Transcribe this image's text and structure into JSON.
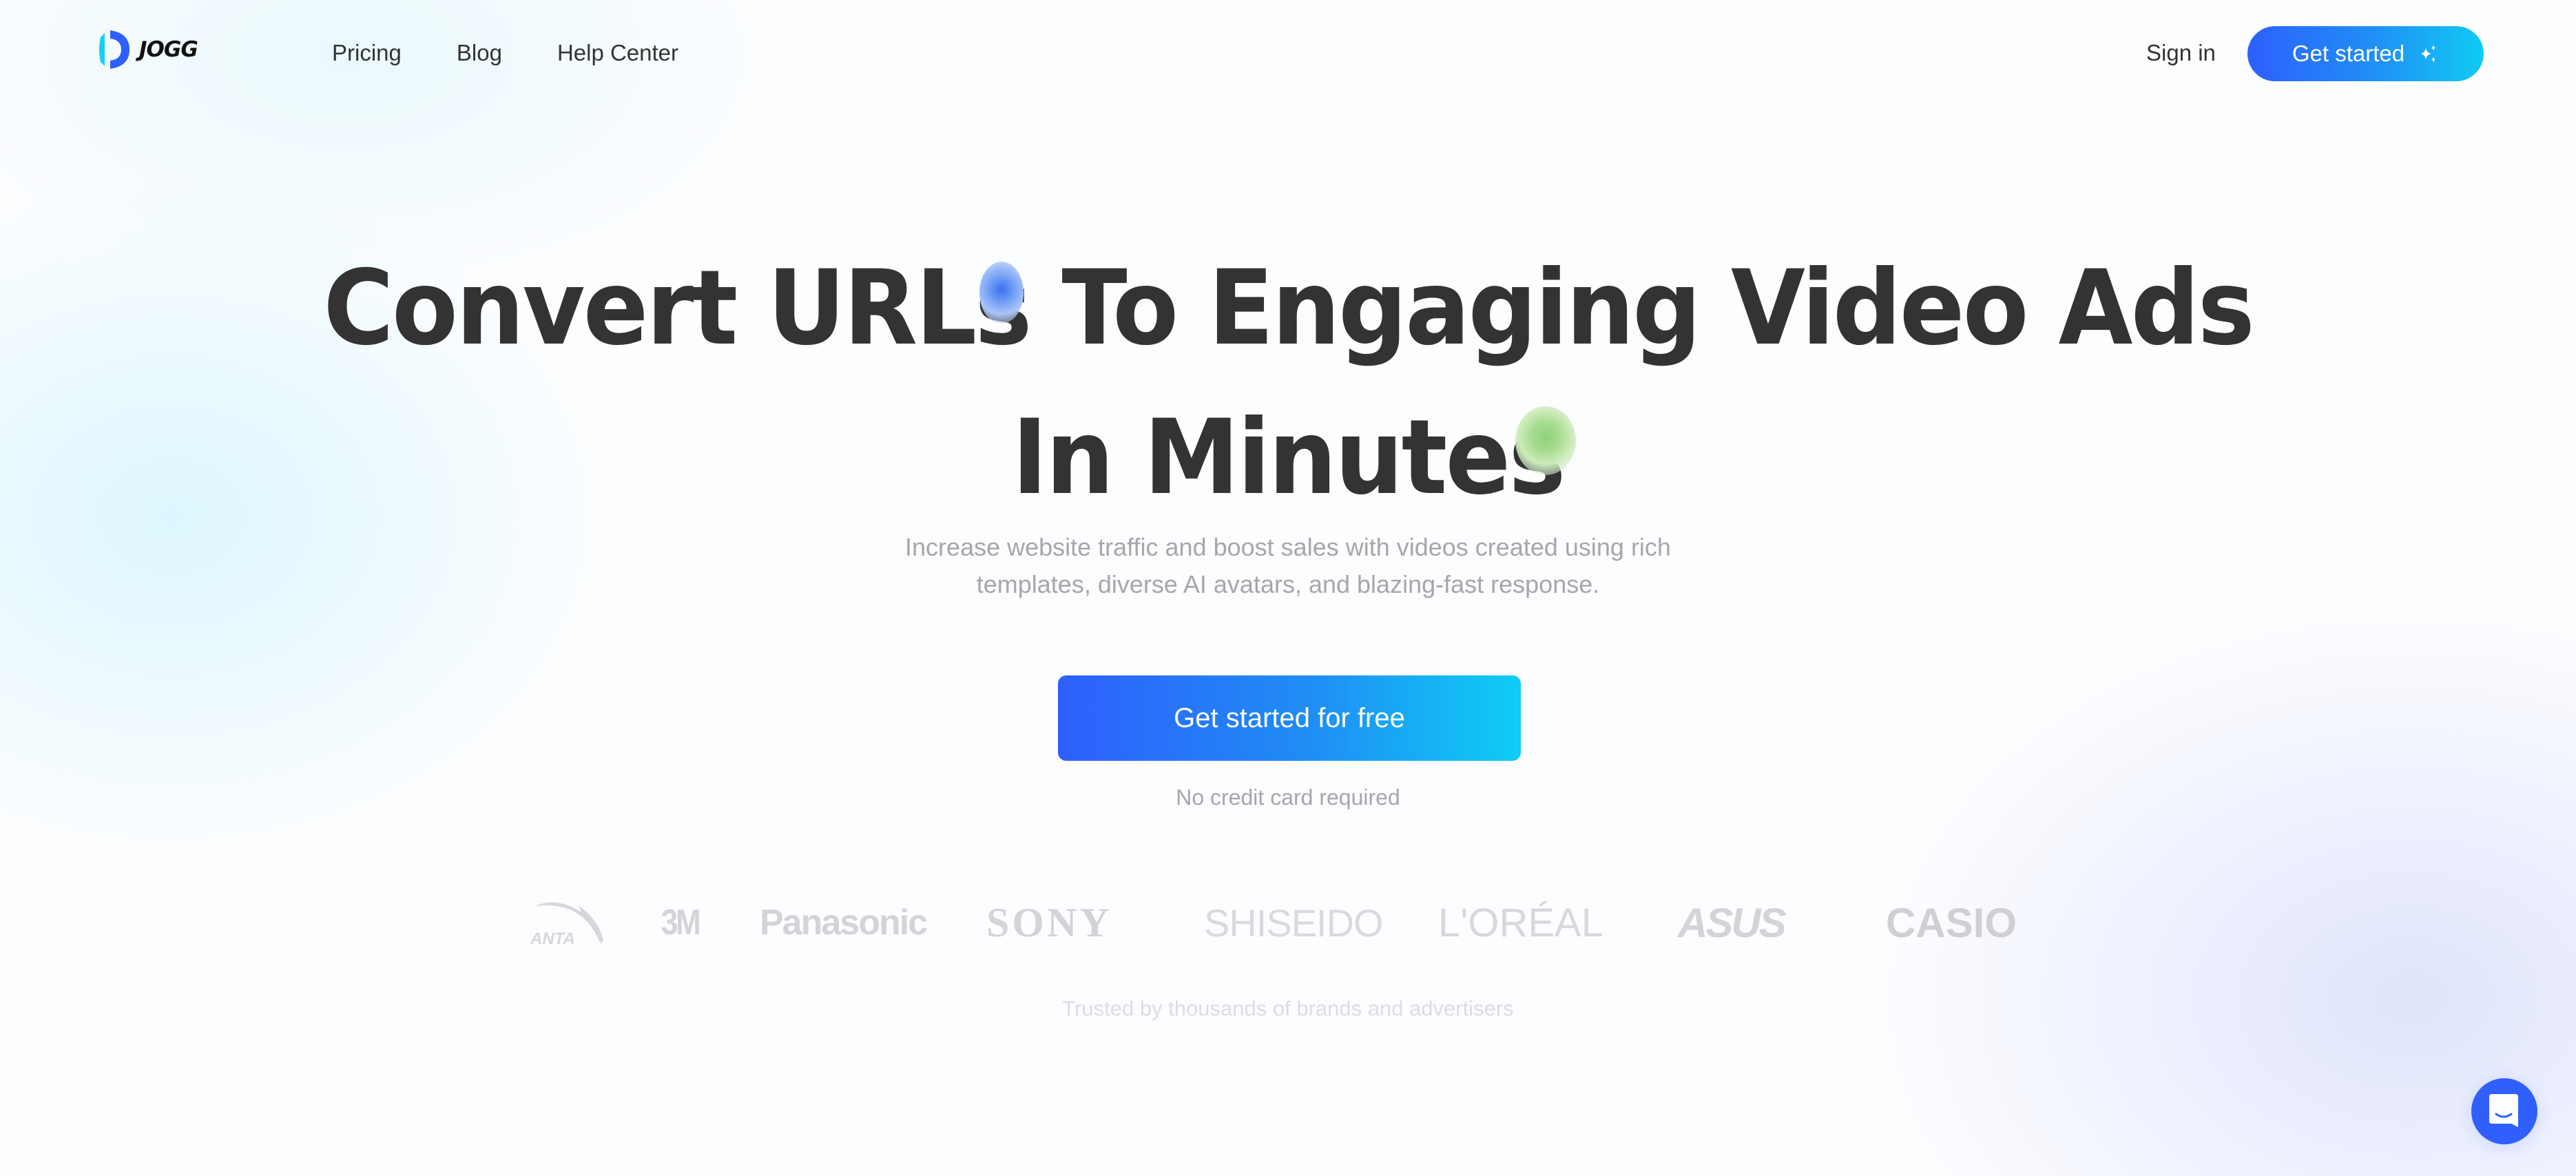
{
  "header": {
    "logo_text": "JOGG",
    "nav": [
      {
        "label": "Pricing"
      },
      {
        "label": "Blog"
      },
      {
        "label": "Help Center"
      }
    ],
    "sign_in": "Sign in",
    "get_started": "Get started",
    "get_started_icon": "sparkles-icon"
  },
  "hero": {
    "title_line1": "Convert URLs To Engaging Video Ads",
    "title_line2": "In Minutes",
    "subtitle_line1": "Increase website traffic and boost sales with videos created using rich",
    "subtitle_line2": "templates, diverse AI avatars, and blazing-fast response.",
    "cta": "Get started for free",
    "cta_note": "No credit card required"
  },
  "brands": {
    "logos": [
      "ANTA",
      "3M",
      "Panasonic",
      "SONY",
      "SHISEIDO",
      "L'ORÉAL",
      "ASUS",
      "CASIO"
    ],
    "caption": "Trusted by thousands of brands and advertisers"
  },
  "chat_widget": {
    "icon": "chat-bubble-icon"
  },
  "colors": {
    "brand_blue": "#2e5ffd",
    "brand_cyan": "#10cbf5",
    "heading": "#333333",
    "muted_text": "#a6a6ab"
  }
}
